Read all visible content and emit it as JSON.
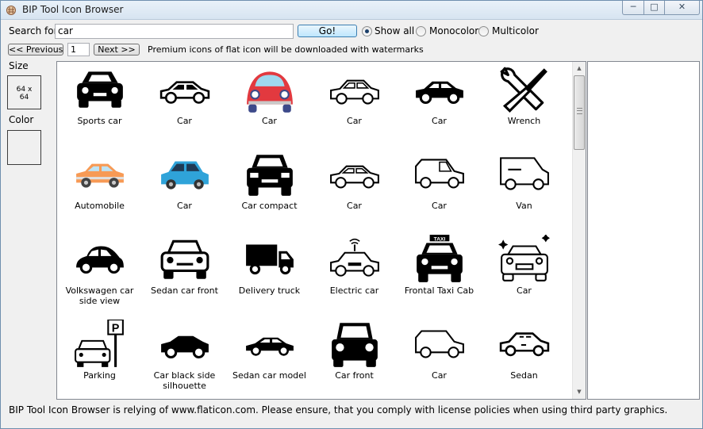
{
  "window": {
    "title": "BIP Tool Icon Browser",
    "controls": [
      "minimize",
      "maximize",
      "close"
    ]
  },
  "search": {
    "label": "Search for",
    "value": "car",
    "go_label": "Go!"
  },
  "filter": {
    "options": [
      {
        "label": "Show all",
        "checked": true
      },
      {
        "label": "Monocolor",
        "checked": false
      },
      {
        "label": "Multicolor",
        "checked": false
      }
    ]
  },
  "paging": {
    "previous_label": "<< Previous",
    "page": "1",
    "next_label": "Next >>",
    "notice": "Premium icons of flat icon will be downloaded with watermarks"
  },
  "sidebar": {
    "size_label": "Size",
    "size_value_line1": "64 x",
    "size_value_line2": "64",
    "color_label": "Color"
  },
  "icons": [
    {
      "label": "Sports car",
      "icon": "sports-car-icon"
    },
    {
      "label": "Car",
      "icon": "car-outline-icon"
    },
    {
      "label": "Car",
      "icon": "beetle-car-icon"
    },
    {
      "label": "Car",
      "icon": "car-outline-icon"
    },
    {
      "label": "Car",
      "icon": "car-silhouette-icon"
    },
    {
      "label": "Wrench",
      "icon": "wrench-icon"
    },
    {
      "label": "Automobile",
      "icon": "automobile-icon"
    },
    {
      "label": "Car",
      "icon": "blue-car-icon"
    },
    {
      "label": "Car compact",
      "icon": "car-compact-icon"
    },
    {
      "label": "Car",
      "icon": "car-outline-icon"
    },
    {
      "label": "Car",
      "icon": "hatchback-icon"
    },
    {
      "label": "Van",
      "icon": "van-icon"
    },
    {
      "label": "Volkswagen car side view",
      "icon": "beetle-car-icon"
    },
    {
      "label": "Sedan car front",
      "icon": "car-front-icon"
    },
    {
      "label": "Delivery truck",
      "icon": "delivery-truck-icon"
    },
    {
      "label": "Electric car",
      "icon": "electric-car-icon"
    },
    {
      "label": "Frontal Taxi Cab",
      "icon": "taxi-icon"
    },
    {
      "label": "Car",
      "icon": "clean-car-icon"
    },
    {
      "label": "Parking",
      "icon": "parking-icon"
    },
    {
      "label": "Car black side silhouette",
      "icon": "car-silhouette-icon"
    },
    {
      "label": "Sedan car model",
      "icon": "sedan-model-icon"
    },
    {
      "label": "Car front",
      "icon": "car-front-icon"
    },
    {
      "label": "Car",
      "icon": "hatchback-icon"
    },
    {
      "label": "Sedan",
      "icon": "sedan-icon"
    }
  ],
  "status": {
    "text": "BIP Tool Icon Browser is relying of www.flaticon.com. Please ensure, that you comply with license policies when using third party graphics."
  },
  "colors": {
    "accent": "#3c7fb1",
    "beetle_red": "#e2393f",
    "blue_car": "#2fa3d9",
    "orange_car": "#f79a55"
  }
}
